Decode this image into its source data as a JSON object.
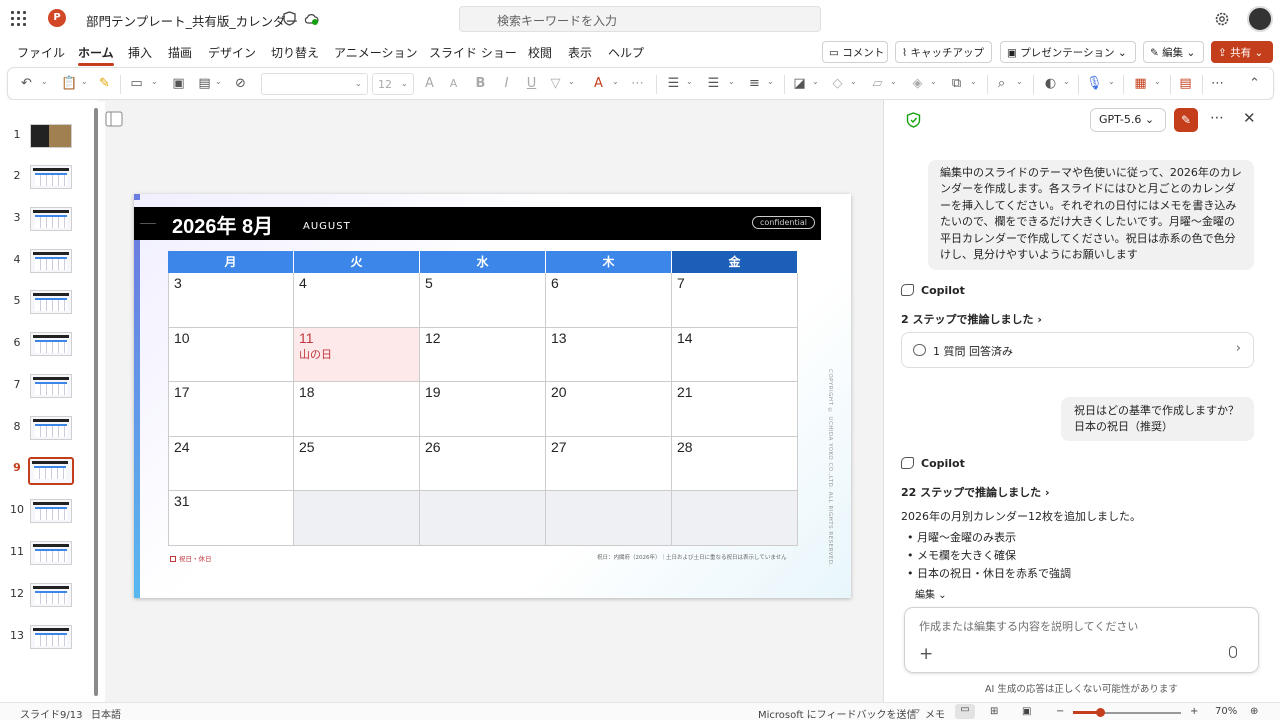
{
  "titlebar": {
    "app_icon": "powerpoint-icon",
    "app_letter": "P",
    "document_title": "部門テンプレート_共有版_カレンダー",
    "search_placeholder": "検索キーワードを入力"
  },
  "menu": {
    "tabs": [
      "ファイル",
      "ホーム",
      "挿入",
      "描画",
      "デザイン",
      "切り替え",
      "アニメーション",
      "スライド ショー",
      "校閲",
      "表示",
      "ヘルプ"
    ],
    "active_tab": "ホーム",
    "comment": "コメント",
    "catchup": "キャッチアップ",
    "present": "プレゼンテーション",
    "edit": "編集",
    "share": "共有"
  },
  "toolbar": {
    "font_size": "12",
    "accent": "#c43e1c"
  },
  "thumbnails": {
    "numbers": [
      "1",
      "2",
      "3",
      "4",
      "5",
      "6",
      "7",
      "8",
      "9",
      "10",
      "11",
      "12",
      "13"
    ],
    "selected": "9"
  },
  "slide": {
    "title": "2026年 8月",
    "subtitle": "AUGUST",
    "badge": "confidential",
    "weekdays": [
      "月",
      "火",
      "水",
      "木",
      "金"
    ],
    "weekday_colors": [
      "#3b86e8",
      "#3b86e8",
      "#3b86e8",
      "#3b86e8",
      "#1c5fb8"
    ],
    "weeks": [
      [
        "3",
        "4",
        "5",
        "6",
        "7"
      ],
      [
        "10",
        "11",
        "12",
        "13",
        "14"
      ],
      [
        "17",
        "18",
        "19",
        "20",
        "21"
      ],
      [
        "24",
        "25",
        "26",
        "27",
        "28"
      ],
      [
        "31",
        "",
        "",
        "",
        ""
      ]
    ],
    "holiday": {
      "day": "11",
      "name": "山の日"
    },
    "holiday_color": "#c0383e",
    "legend": "祝日・休日",
    "note": "祝日：内閣府（2026年）｜土日および土日に重なる祝日は表示していません",
    "copyright": "COPYRIGHT © UCHIDA YOKO CO.,LTD. ALL RIGHTS RESERVED."
  },
  "copilot": {
    "model": "GPT-5.6",
    "user_message_1": "編集中のスライドのテーマや色使いに従って、2026年のカレンダーを作成します。各スライドにはひと月ごとのカレンダーを挿入してください。それぞれの日付にはメモを書き込みたいので、欄をできるだけ大きくしたいです。月曜～金曜の平日カレンダーで作成してください。祝日は赤系の色で色分けし、見分けやすいようにお願いします",
    "name": "Copilot",
    "steps_1": "2 ステップで推論しました",
    "question_card": "1 質問 回答済み",
    "user_message_2_line1": "祝日はどの基準で作成しますか？",
    "user_message_2_line2": "日本の祝日（推奨）",
    "steps_2": "22 ステップで推論しました",
    "answer": "2026年の月別カレンダー12枚を追加しました。",
    "bullets": [
      "月曜～金曜のみ表示",
      "メモ欄を大きく確保",
      "日本の祝日・休日を赤系で強調"
    ],
    "edit_link": "編集",
    "input_placeholder": "作成または編集する内容を説明してください",
    "disclaimer": "AI 生成の応答は正しくない可能性があります"
  },
  "statusbar": {
    "slide_count": "スライド9/13",
    "language": "日本語",
    "feedback": "Microsoft にフィードバックを送信",
    "notes": "メモ",
    "zoom": "70%",
    "zoom_fraction": 0.25
  }
}
